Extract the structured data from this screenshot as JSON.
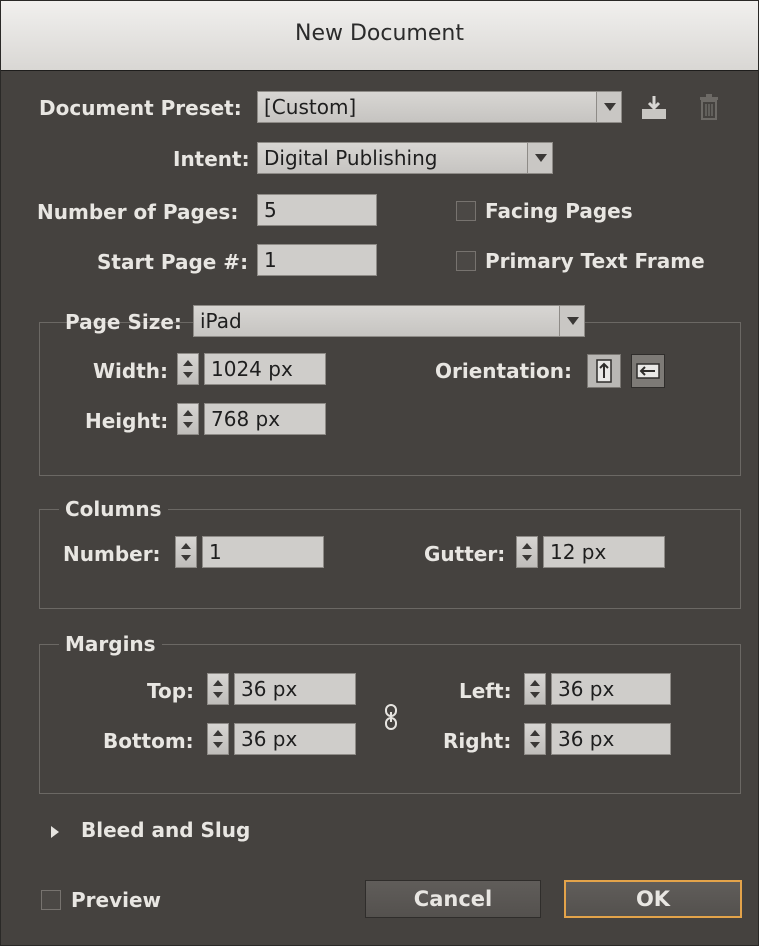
{
  "dialog": {
    "title": "New Document"
  },
  "document_preset": {
    "label": "Document Preset:",
    "value": "[Custom]"
  },
  "intent": {
    "label": "Intent:",
    "value": "Digital Publishing"
  },
  "pages": {
    "number_label": "Number of Pages:",
    "number_value": "5",
    "start_label": "Start Page #:",
    "start_value": "1",
    "facing_label": "Facing Pages",
    "facing_checked": false,
    "primary_label": "Primary Text Frame",
    "primary_checked": false
  },
  "page_size": {
    "label": "Page Size:",
    "value": "iPad",
    "width_label": "Width:",
    "width_value": "1024 px",
    "height_label": "Height:",
    "height_value": "768 px",
    "orientation_label": "Orientation:",
    "orientation_icons": [
      "portrait-icon",
      "landscape-icon"
    ],
    "orientation_selected": "landscape"
  },
  "columns": {
    "title": "Columns",
    "number_label": "Number:",
    "number_value": "1",
    "gutter_label": "Gutter:",
    "gutter_value": "12 px"
  },
  "margins": {
    "title": "Margins",
    "top_label": "Top:",
    "top_value": "36 px",
    "bottom_label": "Bottom:",
    "bottom_value": "36 px",
    "left_label": "Left:",
    "left_value": "36 px",
    "right_label": "Right:",
    "right_value": "36 px",
    "link_icon": "chain-link-icon"
  },
  "bleed": {
    "label": "Bleed and Slug"
  },
  "footer": {
    "preview_label": "Preview",
    "preview_checked": false,
    "cancel_label": "Cancel",
    "ok_label": "OK"
  },
  "colors": {
    "accent": "#e3a34a",
    "panel": "#45423f",
    "field": "#cfcdca"
  }
}
